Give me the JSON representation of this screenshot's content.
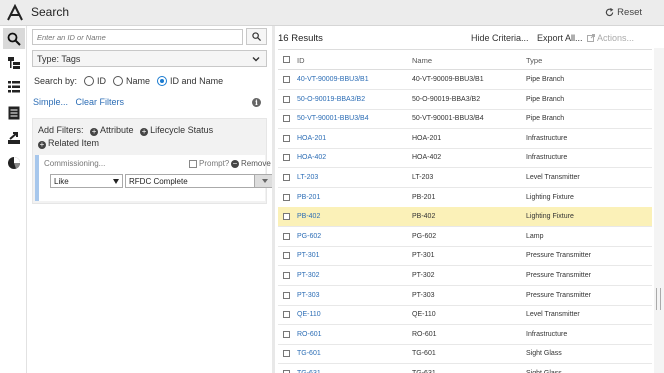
{
  "app": {
    "title": "Search",
    "reset_label": "Reset"
  },
  "rail": {
    "items": [
      "search-icon",
      "hierarchy-icon",
      "list-icon",
      "document-icon",
      "export-icon",
      "chart-icon"
    ]
  },
  "search": {
    "placeholder": "Enter an ID or Name",
    "type_label": "Type: Tags"
  },
  "search_by": {
    "label": "Search by:",
    "options": [
      "ID",
      "Name",
      "ID and Name"
    ],
    "selected": "ID and Name"
  },
  "links": {
    "simple": "Simple...",
    "clear": "Clear Filters"
  },
  "filters": {
    "add_label": "Add Filters:",
    "options": [
      "Attribute",
      "Lifecycle Status",
      "Related Item"
    ],
    "criterion": {
      "name": "Commissioning...",
      "prompt_label": "Prompt?",
      "remove_label": "Remove",
      "operator": "Like",
      "value": "RFDC Complete"
    }
  },
  "results": {
    "count_label": "16 Results",
    "hide_criteria": "Hide Criteria...",
    "export_all": "Export All...",
    "actions": "Actions...",
    "columns": [
      "ID",
      "Name",
      "Type"
    ],
    "rows": [
      {
        "id": "40-VT-90009-BBU3/B1",
        "name": "40-VT-90009-BBU3/B1",
        "type": "Pipe Branch"
      },
      {
        "id": "50-O-90019-BBA3/B2",
        "name": "50-O-90019-BBA3/B2",
        "type": "Pipe Branch"
      },
      {
        "id": "50-VT-90001-BBU3/B4",
        "name": "50-VT-90001-BBU3/B4",
        "type": "Pipe Branch"
      },
      {
        "id": "HOA-201",
        "name": "HOA-201",
        "type": "Infrastructure"
      },
      {
        "id": "HOA-402",
        "name": "HOA-402",
        "type": "Infrastructure"
      },
      {
        "id": "LT-203",
        "name": "LT-203",
        "type": "Level Transmitter"
      },
      {
        "id": "PB-201",
        "name": "PB-201",
        "type": "Lighting Fixture"
      },
      {
        "id": "PB-402",
        "name": "PB-402",
        "type": "Lighting Fixture"
      },
      {
        "id": "PG-602",
        "name": "PG-602",
        "type": "Lamp"
      },
      {
        "id": "PT-301",
        "name": "PT-301",
        "type": "Pressure Transmitter"
      },
      {
        "id": "PT-302",
        "name": "PT-302",
        "type": "Pressure Transmitter"
      },
      {
        "id": "PT-303",
        "name": "PT-303",
        "type": "Pressure Transmitter"
      },
      {
        "id": "QE-110",
        "name": "QE-110",
        "type": "Level Transmitter"
      },
      {
        "id": "RO-601",
        "name": "RO-601",
        "type": "Infrastructure"
      },
      {
        "id": "TG-601",
        "name": "TG-601",
        "type": "Sight Glass"
      },
      {
        "id": "TG-631",
        "name": "TG-631",
        "type": "Sight Glass"
      }
    ],
    "selected_row": 7
  },
  "colors": {
    "link": "#2c6db5",
    "selected_row": "#fbf1b8",
    "radio_on": "#1a7bd0"
  }
}
